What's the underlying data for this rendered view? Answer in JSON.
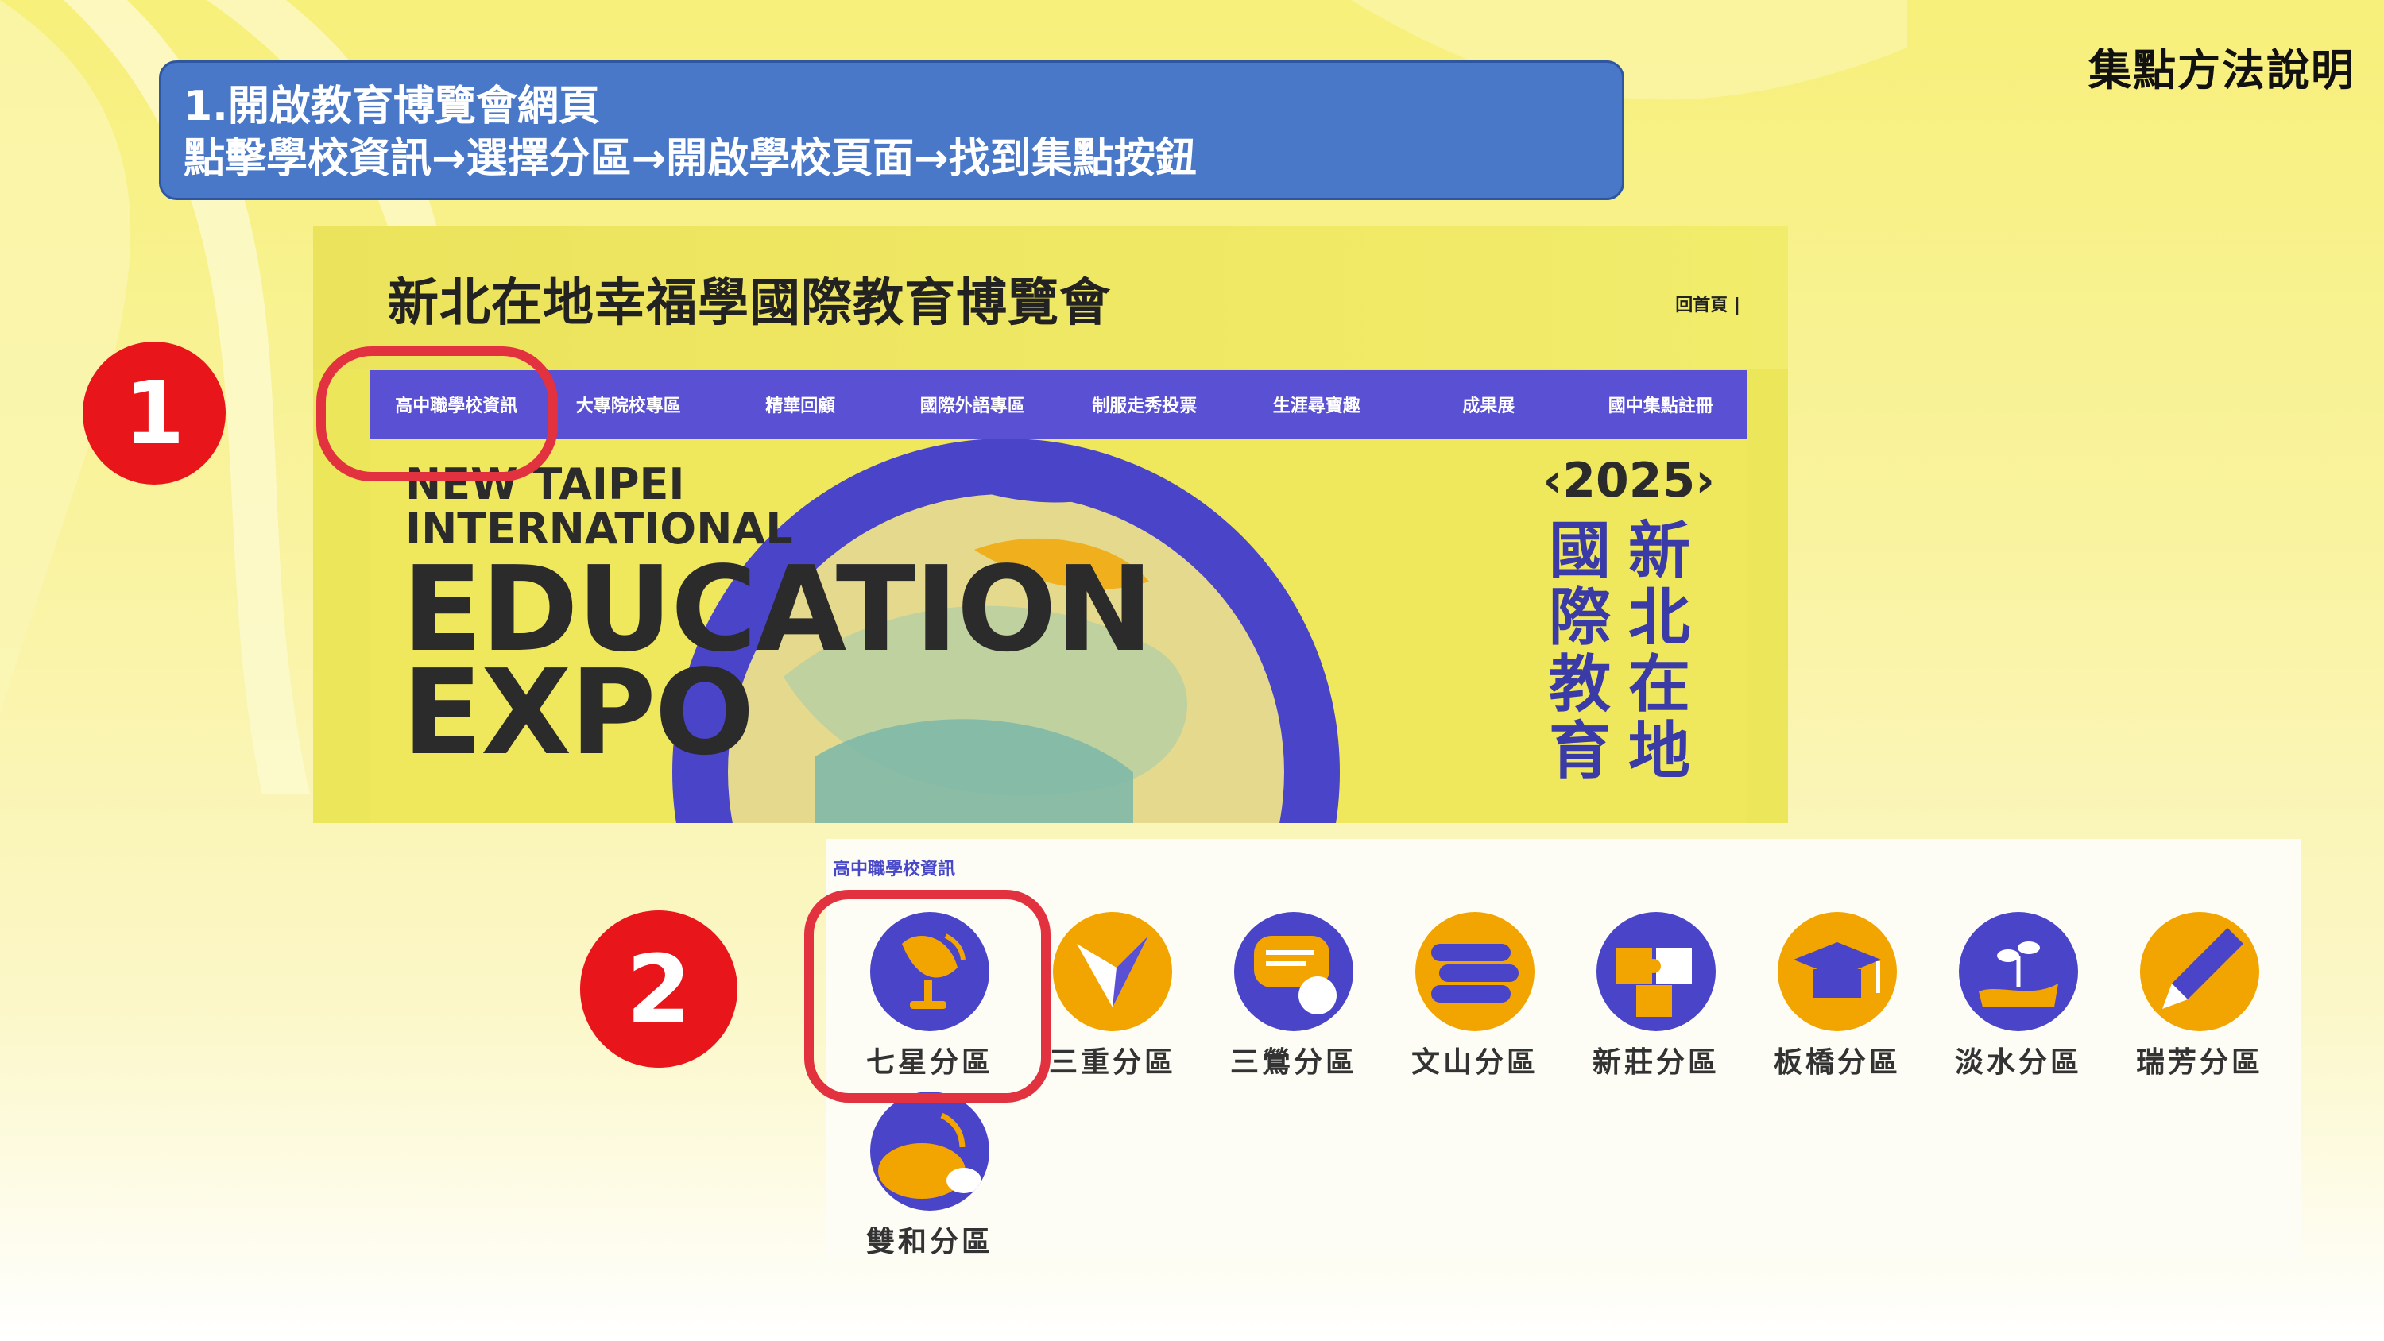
{
  "corner_title": "集點方法說明",
  "instruction": {
    "line1": "1.開啟教育博覽會網頁",
    "line2": "點擊學校資訊→選擇分區→開啟學校頁面→找到集點按鈕"
  },
  "site": {
    "title": "新北在地幸福學國際教育博覽會",
    "home_link": "回首頁 |",
    "nav": [
      "高中職學校資訊",
      "大專院校專區",
      "精華回顧",
      "國際外語專區",
      "制服走秀投票",
      "生涯尋寶趣",
      "成果展",
      "國中集點註冊"
    ],
    "hero": {
      "line1": "NEW TAIPEI",
      "line2": "INTERNATIONAL",
      "line3": "EDUCATION",
      "line4": "EXPO",
      "year": "‹2025›",
      "vertical": [
        "國",
        "新",
        "際",
        "北",
        "教",
        "在",
        "育",
        "地"
      ]
    }
  },
  "markers": {
    "step1": "1",
    "step2": "2"
  },
  "districts": {
    "heading": "高中職學校資訊",
    "items": [
      {
        "label": "七星分區",
        "icon": "satellite-dish-icon"
      },
      {
        "label": "三重分區",
        "icon": "paper-crane-icon"
      },
      {
        "label": "三鶯分區",
        "icon": "chat-bubble-icon"
      },
      {
        "label": "文山分區",
        "icon": "books-icon"
      },
      {
        "label": "新莊分區",
        "icon": "puzzle-icon"
      },
      {
        "label": "板橋分區",
        "icon": "graduation-cap-icon"
      },
      {
        "label": "淡水分區",
        "icon": "plant-hand-icon"
      },
      {
        "label": "瑞芳分區",
        "icon": "fountain-pen-icon"
      },
      {
        "label": "雙和分區",
        "icon": "sun-cloud-icon"
      }
    ]
  },
  "colors": {
    "instruction_bg": "#4a78c9",
    "nav_bg": "#5a50d4",
    "marker_red": "#e8151a",
    "icon_blue": "#4a44c8",
    "icon_orange": "#f2a400"
  }
}
